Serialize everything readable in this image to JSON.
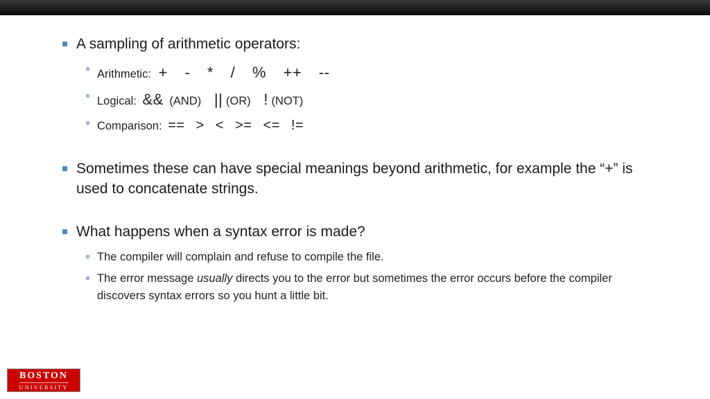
{
  "bullets": {
    "b1": {
      "title": "A sampling of arithmetic operators:",
      "sub": {
        "arith_label": "Arithmetic:",
        "arith_ops": "+   -   *   /   %   ++   --",
        "logic_label": "Logical:",
        "logic_and_sym": "&&",
        "logic_and_txt": "(AND)",
        "logic_or_sym": "||",
        "logic_or_txt": "(OR)",
        "logic_not_sym": "!",
        "logic_not_txt": "(NOT)",
        "comp_label": "Comparison:",
        "comp_ops": "==   >   <  >=   <=   !="
      }
    },
    "b2": "Sometimes these can have special meanings beyond arithmetic, for example the “+” is used to concatenate strings.",
    "b3": {
      "title": "What happens when a syntax error is made?",
      "sub1": "The compiler will complain and refuse to compile the file.",
      "sub2a": "The error message ",
      "sub2b": "usually",
      "sub2c": " directs you to the error but sometimes the error occurs before the compiler discovers syntax errors so you hunt a little bit."
    }
  },
  "logo": {
    "line1": "BOSTON",
    "line2": "UNIVERSITY"
  }
}
